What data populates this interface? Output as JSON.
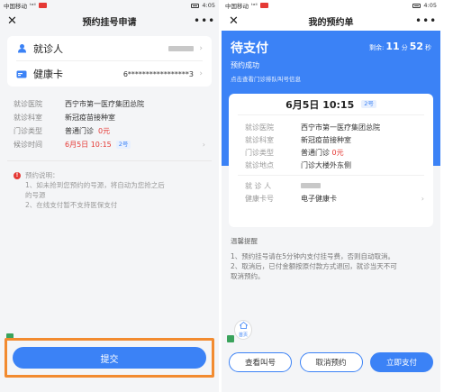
{
  "status_bar": {
    "carrier": "中国移动",
    "signal": "ᵗᵃˡˡ",
    "time": "4:05"
  },
  "left": {
    "nav": {
      "title": "预约挂号申请"
    },
    "patient": {
      "label": "就诊人"
    },
    "card": {
      "label": "健康卡",
      "value": "6*****************3"
    },
    "info": [
      {
        "label": "就诊医院",
        "value": "西宁市第一医疗集团总院"
      },
      {
        "label": "就诊科室",
        "value": "新冠疫苗接种室"
      },
      {
        "label": "门诊类型",
        "value": "普通门诊",
        "extra": "0元"
      },
      {
        "label": "候诊时间",
        "value": "6月5日 10:15",
        "tag": "2号"
      }
    ],
    "notes": {
      "title": "预约说明：",
      "lines": [
        "1、如未抢到您预约的号源，将自动为您抢之后",
        "的号源",
        "2、在线支付暂不支持医保支付"
      ]
    },
    "submit_label": "提交"
  },
  "right": {
    "nav": {
      "title": "我的预约单"
    },
    "pay": {
      "title": "待支付",
      "remain_label": "剩余:",
      "minutes": "11",
      "min_unit": "分",
      "seconds": "52",
      "sec_unit": "秒",
      "status": "预约成功",
      "hint": "点击查看门诊排队叫号信息"
    },
    "order": {
      "date": "6月5日 10:15",
      "tag": "2号",
      "rows": [
        {
          "label": "就诊医院",
          "value": "西宁市第一医疗集团总院"
        },
        {
          "label": "就诊科室",
          "value": "新冠疫苗接种室"
        },
        {
          "label": "门诊类型",
          "value": "普通门诊",
          "extra": "0元"
        },
        {
          "label": "就诊地点",
          "value": "门诊大楼外东侧"
        }
      ],
      "patient_label": "就 诊 人",
      "card_label": "健康卡号",
      "card_value": "电子健康卡"
    },
    "tips": {
      "title": "温馨提醒",
      "lines": [
        "1、预约挂号请在5分钟内支付挂号费，否则自动取消。",
        "2、取消后，已付金额按原付款方式退回，就诊当天不可",
        "取消预约。"
      ]
    },
    "home_label": "首页",
    "buttons": {
      "queue": "查看叫号",
      "cancel": "取消预约",
      "pay": "立即支付"
    }
  },
  "colors": {
    "primary": "#3b82f6",
    "accent_red": "#e53935",
    "highlight_border": "#f28b30"
  }
}
